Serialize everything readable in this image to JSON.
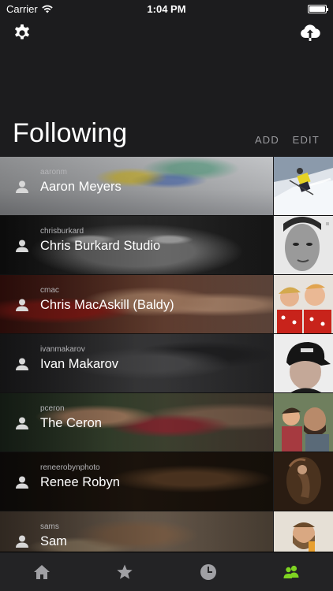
{
  "status_bar": {
    "carrier": "Carrier",
    "time": "1:04 PM",
    "battery_level": 1.0
  },
  "header": {
    "title": "Following",
    "add_label": "ADD",
    "edit_label": "EDIT"
  },
  "following": [
    {
      "username": "aaronm",
      "name": "Aaron Meyers"
    },
    {
      "username": "chrisburkard",
      "name": "Chris Burkard Studio"
    },
    {
      "username": "cmac",
      "name": "Chris MacAskill (Baldy)"
    },
    {
      "username": "ivanmakarov",
      "name": "Ivan Makarov"
    },
    {
      "username": "pceron",
      "name": "The Ceron"
    },
    {
      "username": "reneerobynphoto",
      "name": "Renee Robyn"
    },
    {
      "username": "sams",
      "name": "Sam"
    }
  ],
  "tabs": [
    {
      "icon": "home-icon",
      "active": false
    },
    {
      "icon": "star-icon",
      "active": false
    },
    {
      "icon": "clock-icon",
      "active": false
    },
    {
      "icon": "people-icon",
      "active": true
    }
  ],
  "colors": {
    "active_tab": "#7ed321",
    "inactive_tab": "#a0a0a4",
    "background": "#1c1c1e"
  }
}
